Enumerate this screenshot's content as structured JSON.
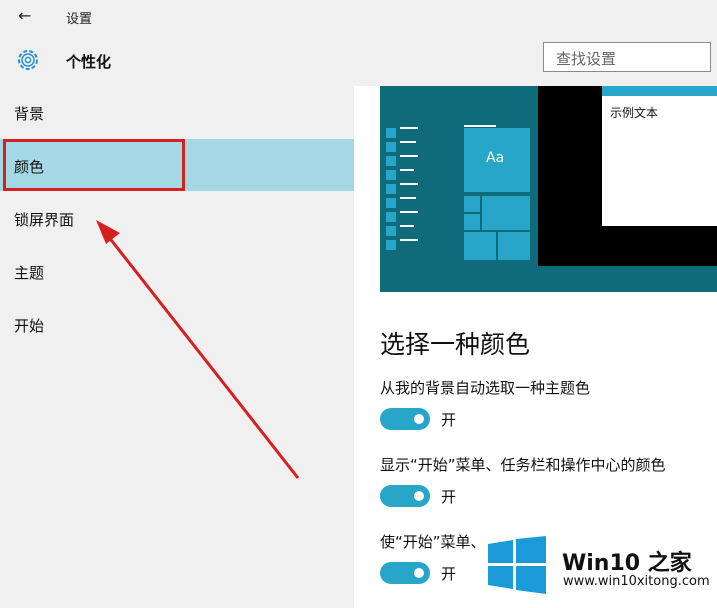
{
  "window": {
    "title": "设置",
    "back_icon": "arrow-left-icon"
  },
  "header": {
    "title": "个性化",
    "icon": "gear-icon",
    "search_placeholder": "查找设置"
  },
  "sidebar": {
    "items": [
      {
        "label": "背景"
      },
      {
        "label": "颜色"
      },
      {
        "label": "锁屏界面"
      },
      {
        "label": "主题"
      },
      {
        "label": "开始"
      }
    ]
  },
  "preview": {
    "sample_text": "示例文本",
    "tile_text": "Aa"
  },
  "main": {
    "section_title": "选择一种颜色",
    "options": [
      {
        "label": "从我的背景自动选取一种主题色",
        "state": "开"
      },
      {
        "label": "显示“开始”菜单、任务栏和操作中心的颜色",
        "state": "开"
      },
      {
        "label": "使“开始”菜单、",
        "state": "开"
      }
    ]
  },
  "watermark": {
    "brand": "Win10 之家",
    "url": "www.win10xitong.com"
  },
  "colors": {
    "accent": "#27a6c9",
    "selected_bg": "#a3d8e4",
    "annotation_red": "#d62020"
  }
}
